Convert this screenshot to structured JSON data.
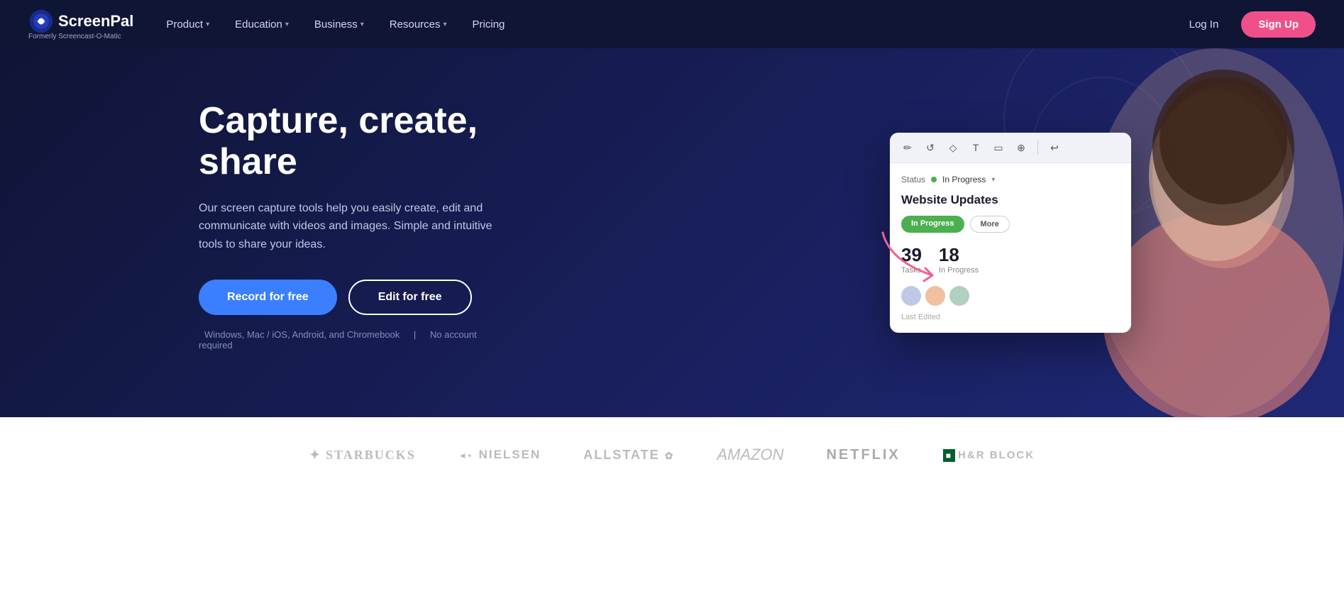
{
  "brand": {
    "name": "ScreenPal",
    "formerly": "Formerly Screencast-O-Matic"
  },
  "nav": {
    "links": [
      {
        "label": "Product",
        "hasDropdown": true
      },
      {
        "label": "Education",
        "hasDropdown": true
      },
      {
        "label": "Business",
        "hasDropdown": true
      },
      {
        "label": "Resources",
        "hasDropdown": true
      },
      {
        "label": "Pricing",
        "hasDropdown": false
      }
    ],
    "login_label": "Log In",
    "signup_label": "Sign Up"
  },
  "hero": {
    "title": "Capture, create, share",
    "description": "Our screen capture tools help you easily create, edit and communicate with videos and images. Simple and intuitive tools to share your ideas.",
    "btn_record": "Record for free",
    "btn_edit": "Edit for free",
    "note_platforms": "Windows, Mac / iOS, Android, and Chromebook",
    "note_account": "No account required"
  },
  "ui_card": {
    "toolbar_icons": [
      "✏️",
      "↺",
      "◇",
      "T",
      "▭",
      "🔍",
      "↩"
    ],
    "status": "In Progress",
    "title": "Website Updates",
    "tabs": [
      "In Progress",
      "More"
    ],
    "stats": [
      {
        "number": "39",
        "label": "Tasks"
      },
      {
        "number": "18",
        "label": "In Progress"
      }
    ],
    "last_edited_label": "Last Edited"
  },
  "brands": [
    {
      "name": "STARBUCKS",
      "style": "starbucks"
    },
    {
      "name": "◄• Nielsen",
      "style": "nielsen"
    },
    {
      "name": "Allstate ❋",
      "style": "allstate"
    },
    {
      "name": "amazon",
      "style": "amazon"
    },
    {
      "name": "NETFLIX",
      "style": "netflix"
    },
    {
      "name": "■ H&R BLOCK",
      "style": "hrblock"
    }
  ]
}
